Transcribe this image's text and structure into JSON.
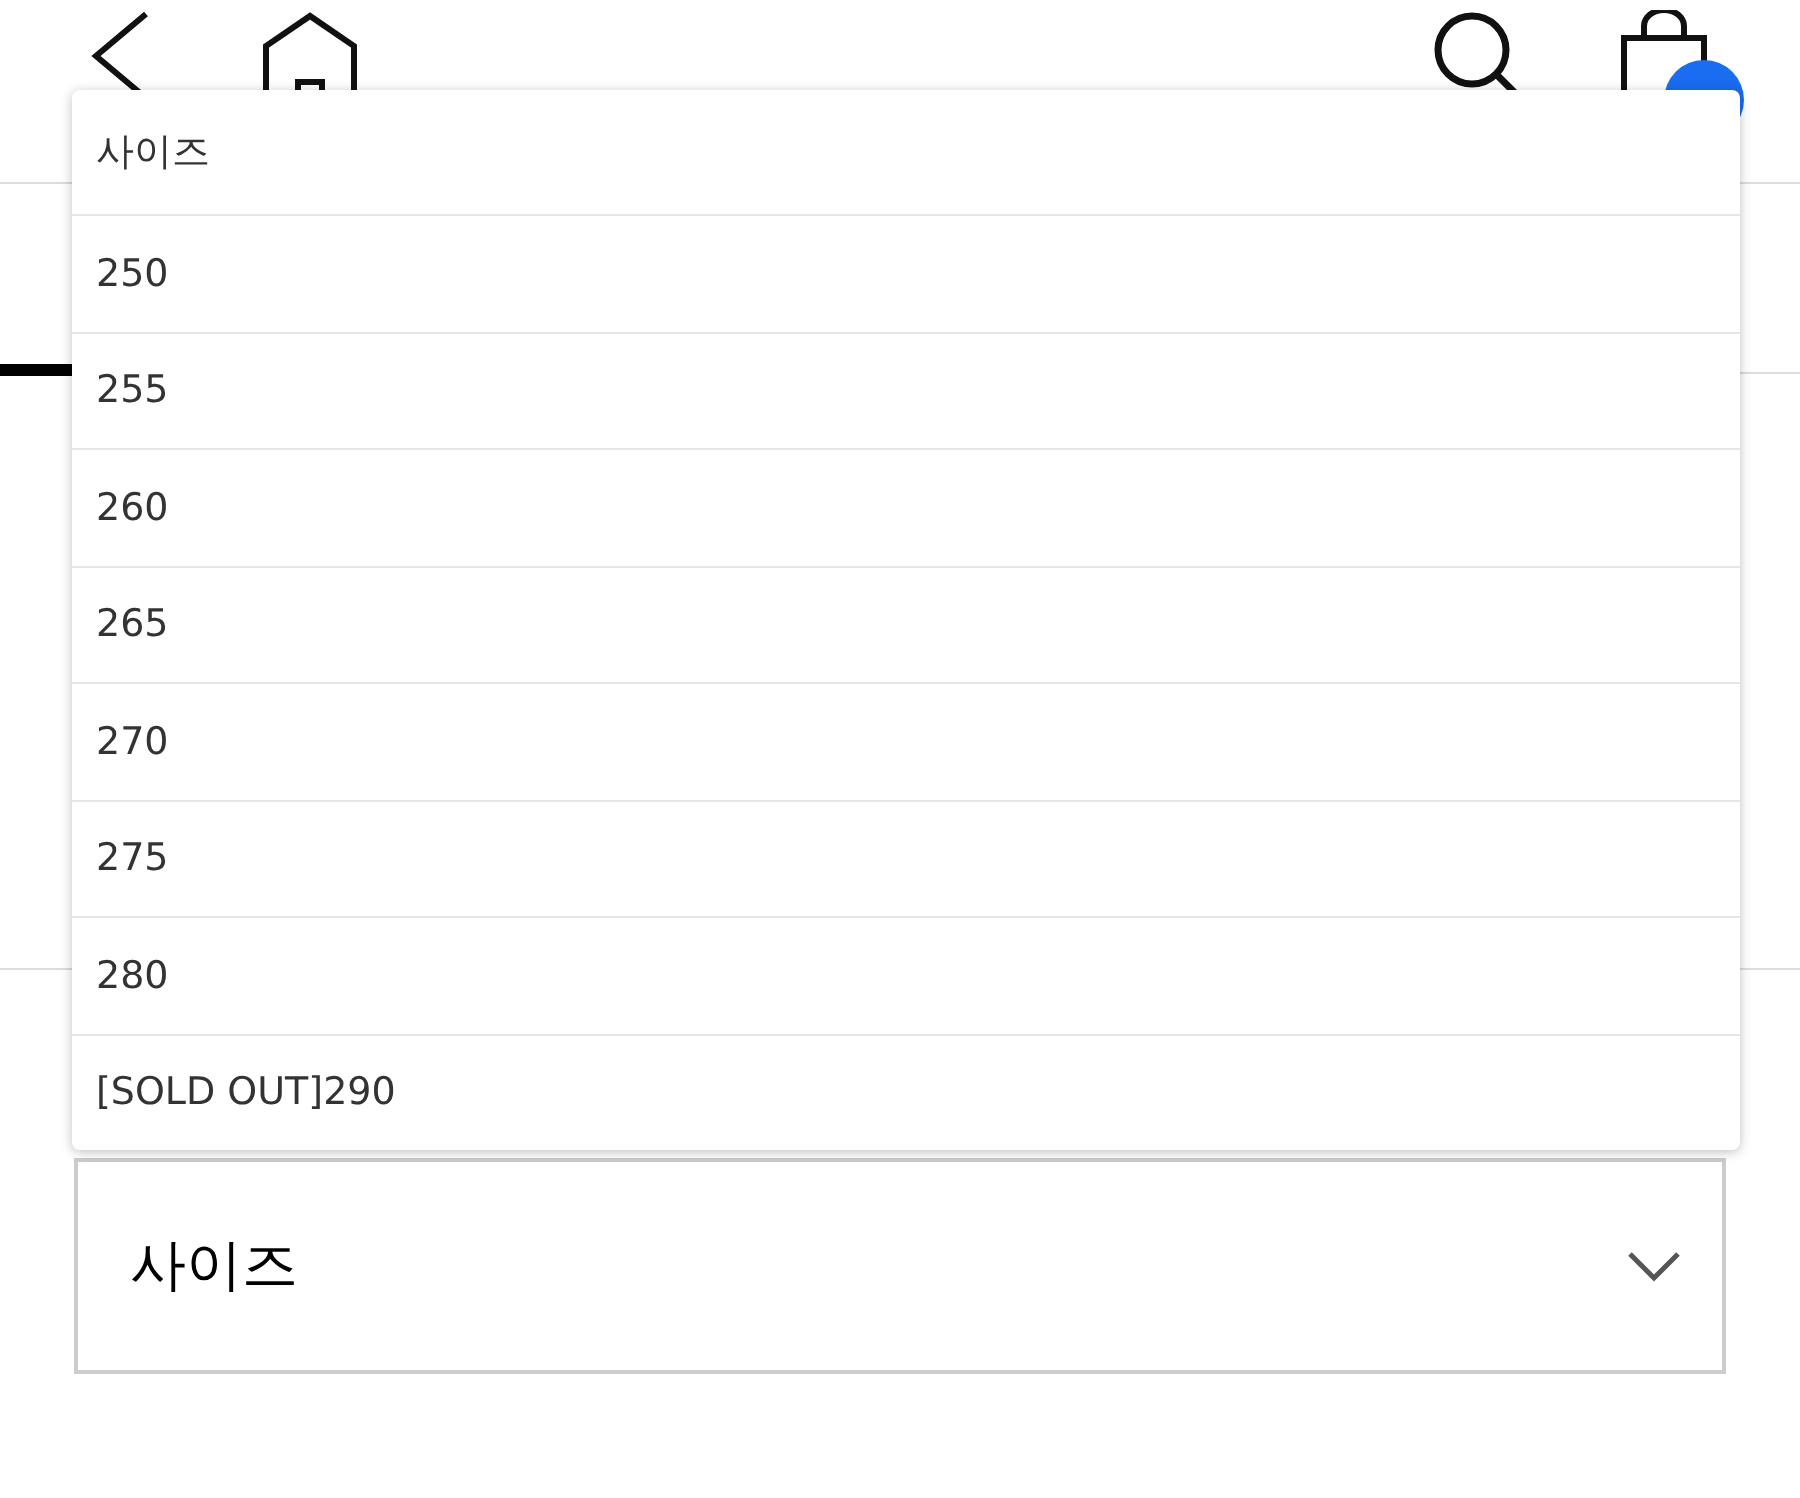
{
  "header": {
    "cart_badge": true
  },
  "size_menu": {
    "expanded": true,
    "options": [
      {
        "label": "사이즈",
        "kind": "placeholder"
      },
      {
        "label": "250",
        "kind": "size"
      },
      {
        "label": "255",
        "kind": "size"
      },
      {
        "label": "260",
        "kind": "size"
      },
      {
        "label": "265",
        "kind": "size"
      },
      {
        "label": "270",
        "kind": "size"
      },
      {
        "label": "275",
        "kind": "size"
      },
      {
        "label": "280",
        "kind": "size"
      },
      {
        "label": "[SOLD OUT]290",
        "kind": "size"
      }
    ]
  },
  "size_select": {
    "value": "사이즈"
  }
}
